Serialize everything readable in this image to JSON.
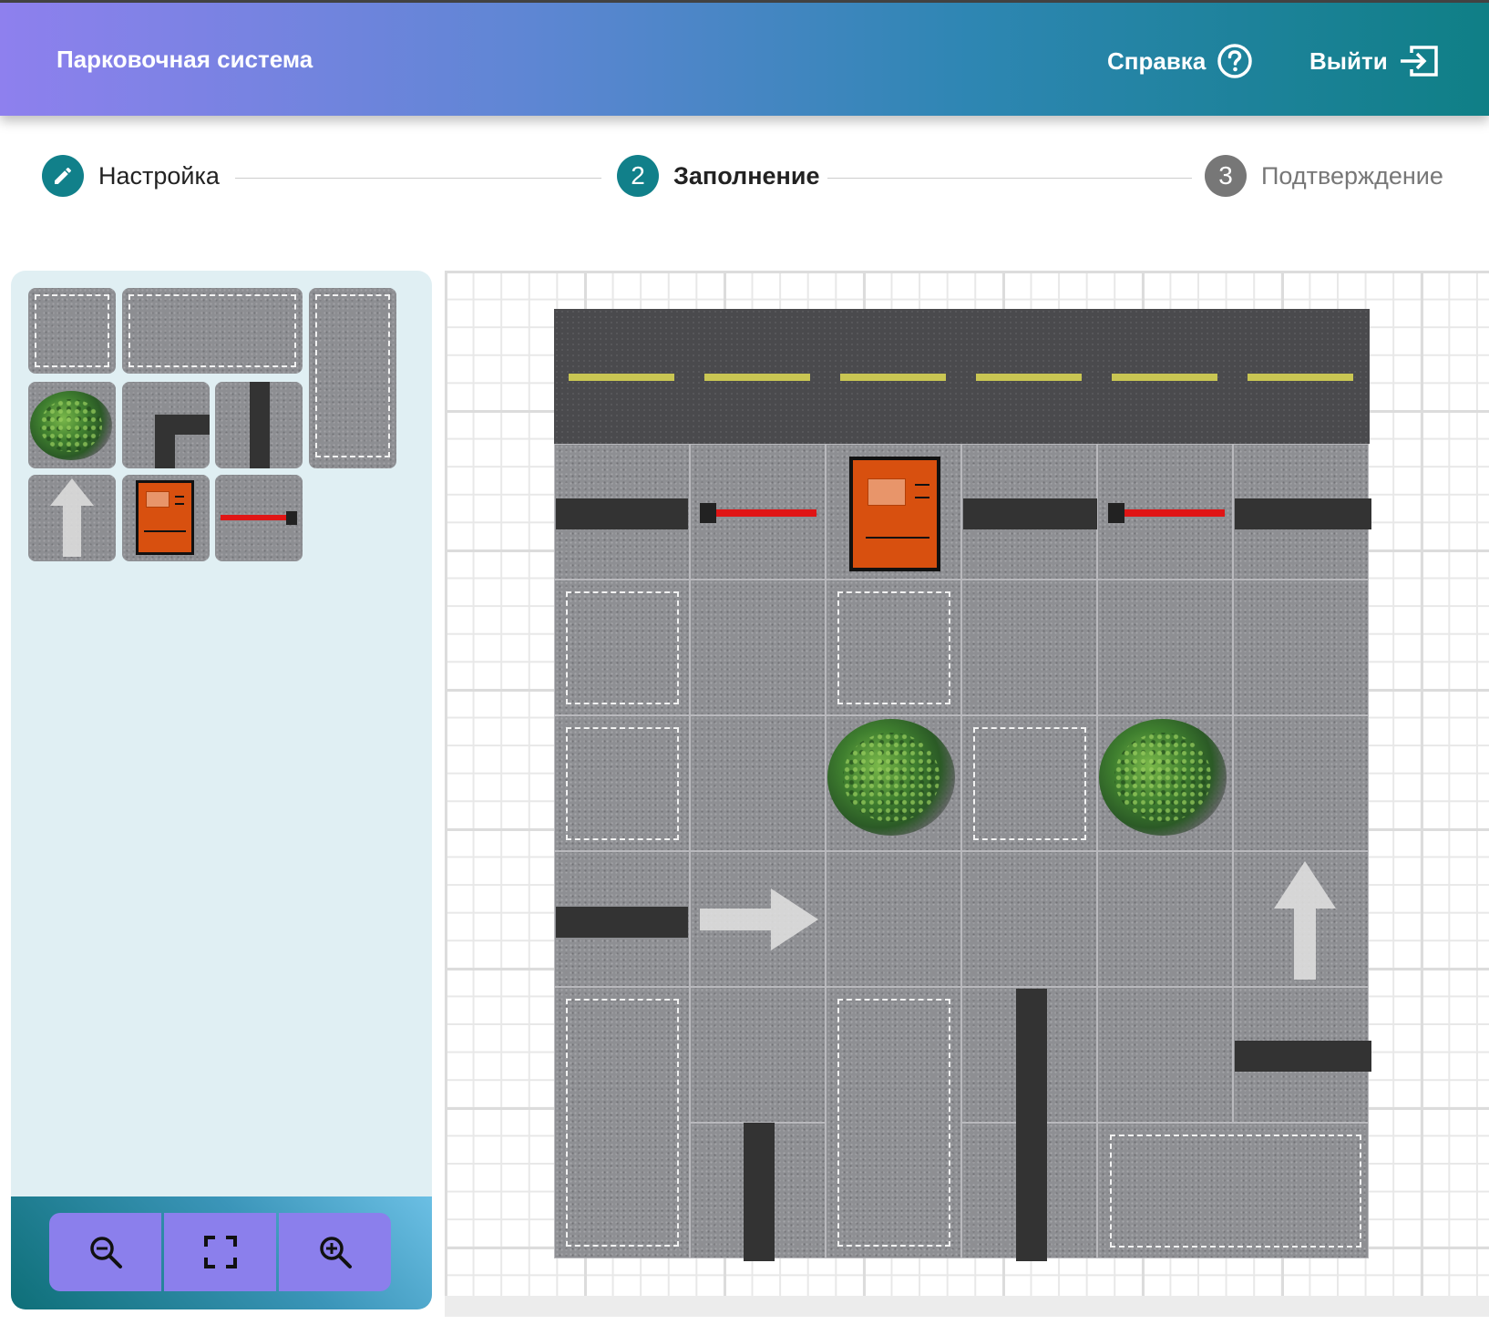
{
  "header": {
    "title": "Парковочная система",
    "help_label": "Справка",
    "logout_label": "Выйти",
    "help_icon": "question-circle-icon",
    "logout_icon": "exit-icon"
  },
  "stepper": {
    "steps": [
      {
        "label": "Настройка",
        "marker": "",
        "state": "completed",
        "icon": "pencil-icon"
      },
      {
        "label": "Заполнение",
        "marker": "2",
        "state": "active"
      },
      {
        "label": "Подтверждение",
        "marker": "3",
        "state": "pending"
      }
    ]
  },
  "palette": {
    "items": [
      "parking-spot-small",
      "parking-spot-wide",
      "parking-spot-tall",
      "bush",
      "wall-corner",
      "wall-vertical",
      "arrow-up",
      "payment-kiosk",
      "barrier"
    ]
  },
  "zoom": {
    "zoom_out_icon": "zoom-out-icon",
    "fit_icon": "fit-screen-icon",
    "zoom_in_icon": "zoom-in-icon"
  },
  "colors": {
    "accent": "#11808a",
    "header_start": "#8e80ee",
    "header_end": "#0f7f86",
    "zoom_button": "#8b7fec",
    "barrier": "#e01515",
    "kiosk": "#d8500f",
    "lane_marking": "#c9c653"
  }
}
